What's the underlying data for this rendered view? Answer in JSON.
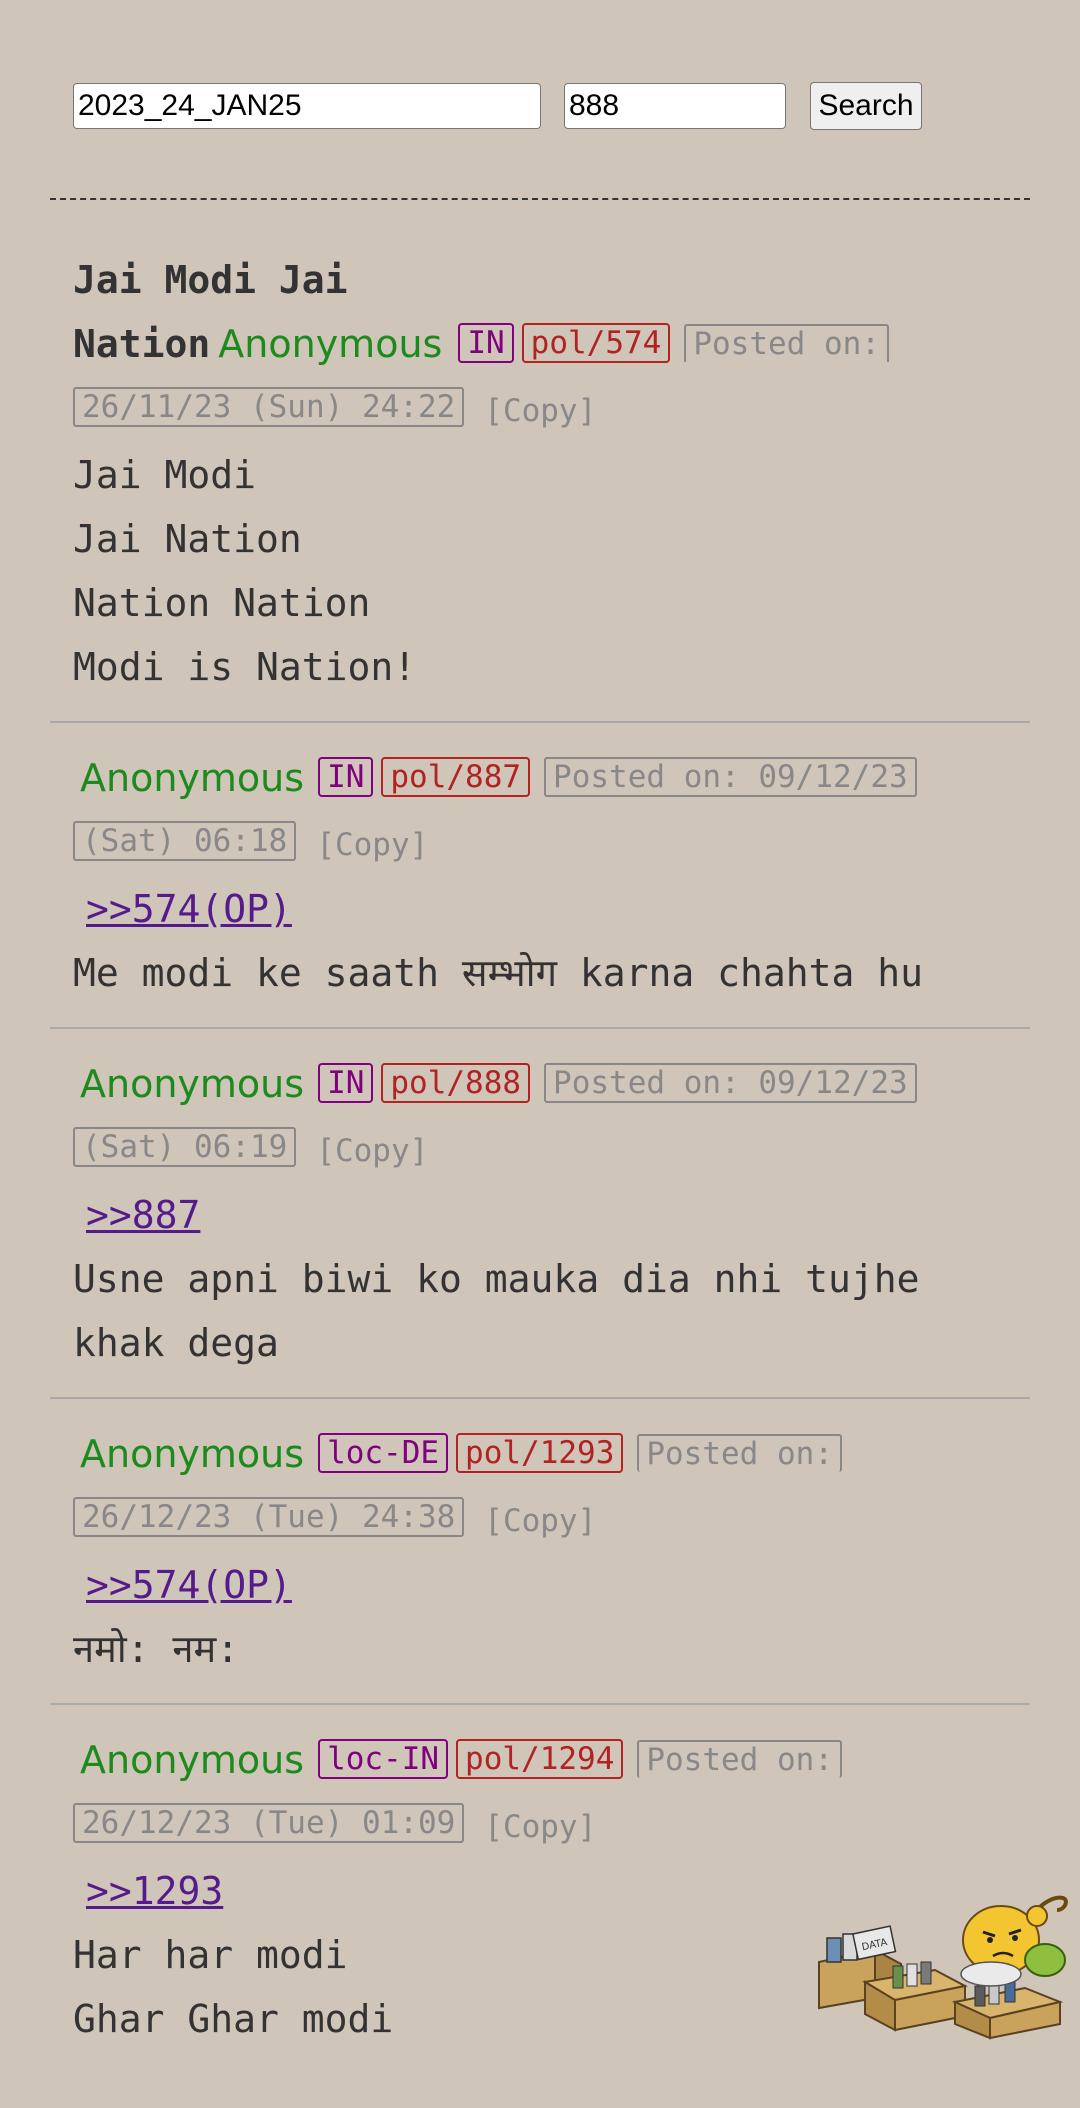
{
  "search": {
    "archive_value": "2023_24_JAN25",
    "thread_value": "888",
    "button_label": "Search"
  },
  "posts": [
    {
      "subject_line1": "Jai Modi Jai",
      "subject_line2": "Nation",
      "name": "Anonymous",
      "country": "IN",
      "post_no": "pol/574",
      "date_part1": "Posted on:",
      "date_part2": "26/11/23 (Sun) 24:22",
      "copy": "[Copy]",
      "body": [
        "Jai Modi",
        "Jai Nation",
        "Nation Nation",
        "Modi is Nation!"
      ]
    },
    {
      "name": "Anonymous",
      "country": "IN",
      "post_no": "pol/887",
      "date_part1": "Posted on: 09/12/23",
      "date_part2": "(Sat) 06:18",
      "copy": "[Copy]",
      "reply": ">>574(OP)",
      "body": [
        "Me modi ke saath सम्भोग karna chahta hu"
      ]
    },
    {
      "name": "Anonymous",
      "country": "IN",
      "post_no": "pol/888",
      "date_part1": "Posted on: 09/12/23",
      "date_part2": "(Sat) 06:19",
      "copy": "[Copy]",
      "reply": ">>887",
      "body": [
        "Usne apni biwi ko mauka dia nhi tujhe",
        "khak dega"
      ]
    },
    {
      "name": "Anonymous",
      "country": "loc-DE",
      "post_no": "pol/1293",
      "date_part1": "Posted on:",
      "date_part2": "26/12/23 (Tue) 24:38",
      "copy": "[Copy]",
      "reply": ">>574(OP)",
      "body": [
        "नमो: नम:"
      ]
    },
    {
      "name": "Anonymous",
      "country": "loc-IN",
      "post_no": "pol/1294",
      "date_part1": "Posted on:",
      "date_part2": "26/12/23 (Tue) 01:09",
      "copy": "[Copy]",
      "reply": ">>1293",
      "body": [
        "Har har modi",
        "Ghar Ghar modi"
      ]
    }
  ],
  "mascot": {
    "icon": "mascot-with-data-boxes-icon",
    "box_label": "DATA"
  }
}
